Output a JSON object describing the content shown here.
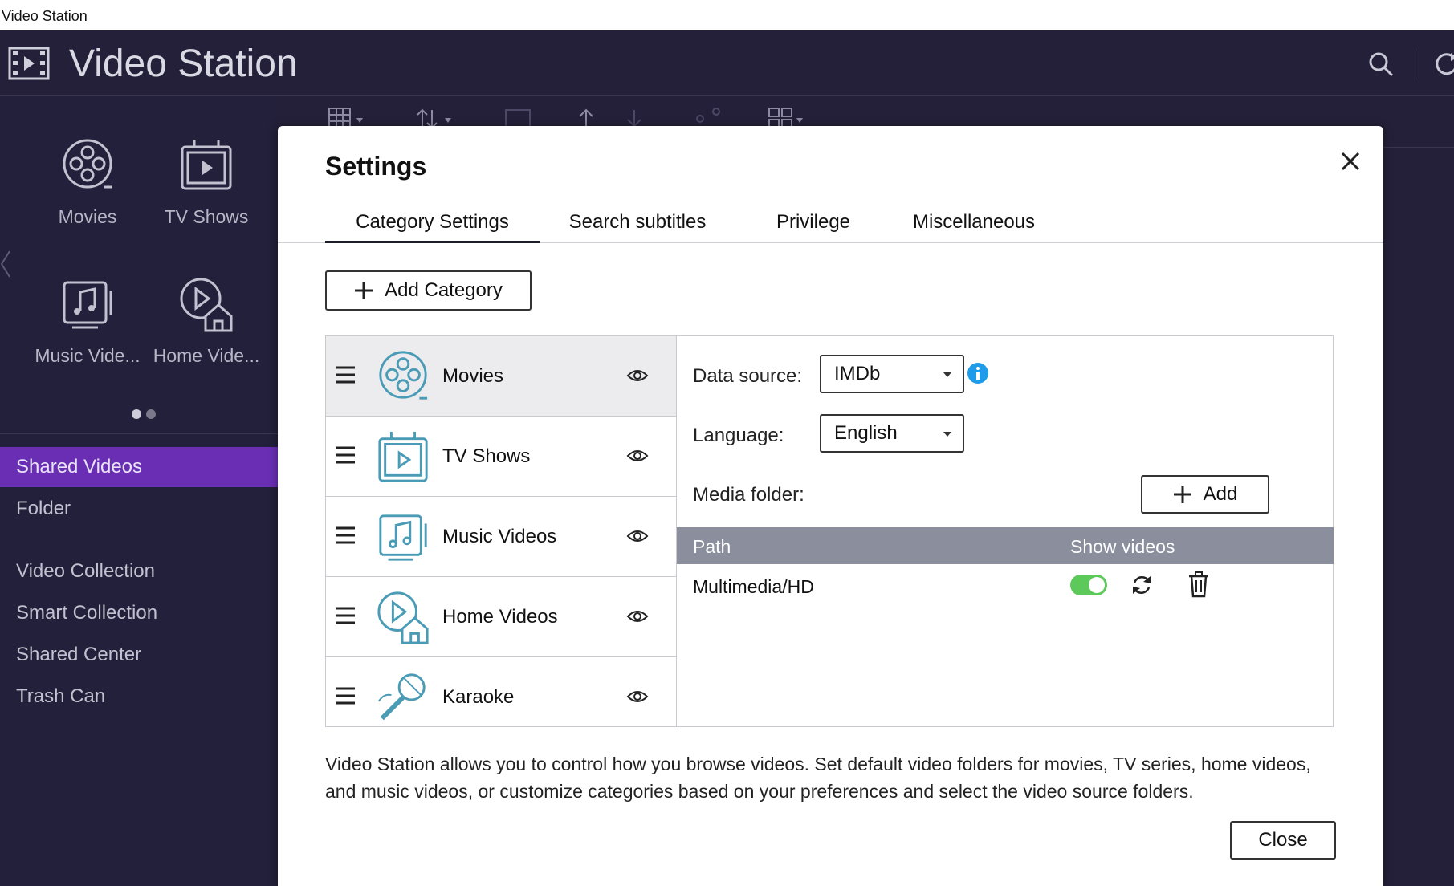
{
  "window": {
    "title": "Video Station"
  },
  "app": {
    "title": "Video Station"
  },
  "sidebar": {
    "tiles": [
      {
        "label": "Movies",
        "icon": "film-reel-icon"
      },
      {
        "label": "TV Shows",
        "icon": "tv-icon"
      },
      {
        "label": "Music Vide...",
        "icon": "music-video-icon"
      },
      {
        "label": "Home Vide...",
        "icon": "home-video-icon"
      }
    ],
    "nav": [
      {
        "label": "Shared Videos",
        "active": true
      },
      {
        "label": "Folder"
      },
      {
        "label": "Video Collection"
      },
      {
        "label": "Smart Collection"
      },
      {
        "label": "Shared Center"
      },
      {
        "label": "Trash Can"
      }
    ]
  },
  "dialog": {
    "title": "Settings",
    "tabs": [
      {
        "label": "Category Settings",
        "active": true
      },
      {
        "label": "Search subtitles"
      },
      {
        "label": "Privilege"
      },
      {
        "label": "Miscellaneous"
      }
    ],
    "add_category_label": "Add Category",
    "categories": [
      {
        "name": "Movies",
        "icon": "film-reel-icon",
        "selected": true
      },
      {
        "name": "TV Shows",
        "icon": "tv-icon"
      },
      {
        "name": "Music Videos",
        "icon": "music-video-icon"
      },
      {
        "name": "Home Videos",
        "icon": "home-video-icon"
      },
      {
        "name": "Karaoke",
        "icon": "microphone-icon"
      }
    ],
    "details": {
      "data_source_label": "Data source:",
      "data_source_value": "IMDb",
      "language_label": "Language:",
      "language_value": "English",
      "media_folder_label": "Media folder:",
      "add_label": "Add",
      "columns": [
        "Path",
        "Show videos"
      ],
      "rows": [
        {
          "path": "Multimedia/HD",
          "show_videos": true
        }
      ]
    },
    "description": "Video Station allows you to control how you browse videos. Set default video folders for movies, TV series, home videos, and music videos, or customize categories based on your preferences and select the video source folders.",
    "close_label": "Close"
  },
  "colors": {
    "accent": "#6a2eb5",
    "toggle_on": "#5cc95a",
    "info": "#1e9be9",
    "icon_teal": "#4a9bb5"
  }
}
